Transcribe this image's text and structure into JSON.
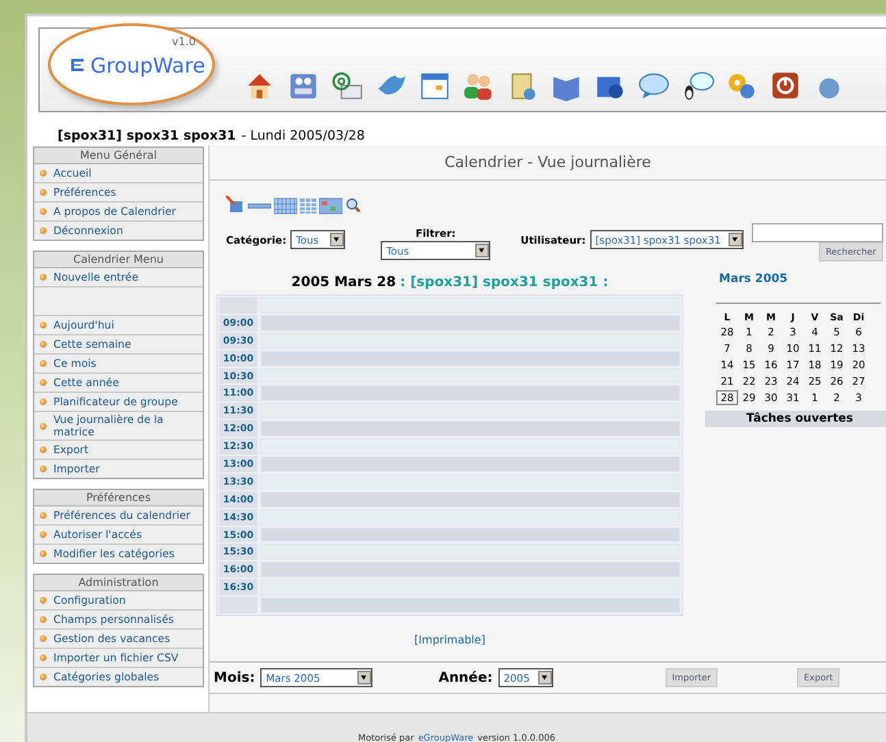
{
  "logo": {
    "version": "v1.0",
    "name": "GroupWare"
  },
  "user_line": {
    "user": "[spox31] spox31 spox31",
    "date": "- Lundi 2005/03/28"
  },
  "sidebar": [
    {
      "title": "Menu Général",
      "items": [
        {
          "kind": "link",
          "label": "Accueil"
        },
        {
          "kind": "link",
          "label": "Préférences"
        },
        {
          "kind": "link",
          "label": "A propos de Calendrier"
        },
        {
          "kind": "link",
          "label": "Déconnexion"
        }
      ]
    },
    {
      "title": "Calendrier Menu",
      "items": [
        {
          "kind": "link",
          "label": "Nouvelle entrée"
        },
        {
          "kind": "spacer"
        },
        {
          "kind": "link",
          "label": "Aujourd'hui"
        },
        {
          "kind": "link",
          "label": "Cette semaine"
        },
        {
          "kind": "link",
          "label": "Ce mois"
        },
        {
          "kind": "link",
          "label": "Cette année"
        },
        {
          "kind": "link",
          "label": "Planificateur de groupe"
        },
        {
          "kind": "link",
          "label": "Vue journalière de la matrice"
        },
        {
          "kind": "link",
          "label": "Export"
        },
        {
          "kind": "link",
          "label": "Importer"
        }
      ]
    },
    {
      "title": "Préférences",
      "items": [
        {
          "kind": "link",
          "label": "Préférences du calendrier"
        },
        {
          "kind": "link",
          "label": "Autoriser l'accés"
        },
        {
          "kind": "link",
          "label": "Modifier les catégories"
        }
      ]
    },
    {
      "title": "Administration",
      "items": [
        {
          "kind": "link",
          "label": "Configuration"
        },
        {
          "kind": "link",
          "label": "Champs personnalisés"
        },
        {
          "kind": "link",
          "label": "Gestion des vacances"
        },
        {
          "kind": "link",
          "label": "Importer un fichier CSV"
        },
        {
          "kind": "link",
          "label": "Catégories globales"
        }
      ]
    }
  ],
  "page_title": "Calendrier - Vue journalière",
  "filters": {
    "category_label": "Catégorie:",
    "category_value": "Tous",
    "filter_label": "Filtrer:",
    "filter_value": "Tous",
    "user_label": "Utilisateur:",
    "user_value": "[spox31] spox31 spox31",
    "search_button": "Rechercher"
  },
  "day_heading": {
    "date": "2005 Mars 28",
    "user": ": [spox31] spox31 spox31 :"
  },
  "slots": [
    "09:00",
    "09:30",
    "10:00",
    "10:30",
    "11:00",
    "11:30",
    "12:00",
    "12:30",
    "13:00",
    "13:30",
    "14:00",
    "14:30",
    "15:00",
    "15:30",
    "16:00",
    "16:30"
  ],
  "printable_link": "[Imprimable]",
  "mini_calendar": {
    "title": "Mars 2005",
    "weekdays": [
      "L",
      "M",
      "M",
      "J",
      "V",
      "Sa",
      "Di"
    ],
    "weeks": [
      [
        {
          "label": "28",
          "selected": false
        },
        {
          "label": "1",
          "selected": false
        },
        {
          "label": "2",
          "selected": false
        },
        {
          "label": "3",
          "selected": false
        },
        {
          "label": "4",
          "selected": false
        },
        {
          "label": "5",
          "selected": false
        },
        {
          "label": "6",
          "selected": false
        }
      ],
      [
        {
          "label": "7",
          "selected": false
        },
        {
          "label": "8",
          "selected": false
        },
        {
          "label": "9",
          "selected": false
        },
        {
          "label": "10",
          "selected": false
        },
        {
          "label": "11",
          "selected": false
        },
        {
          "label": "12",
          "selected": false
        },
        {
          "label": "13",
          "selected": false
        }
      ],
      [
        {
          "label": "14",
          "selected": false
        },
        {
          "label": "15",
          "selected": false
        },
        {
          "label": "16",
          "selected": false
        },
        {
          "label": "17",
          "selected": false
        },
        {
          "label": "18",
          "selected": false
        },
        {
          "label": "19",
          "selected": false
        },
        {
          "label": "20",
          "selected": false
        }
      ],
      [
        {
          "label": "21",
          "selected": false
        },
        {
          "label": "22",
          "selected": false
        },
        {
          "label": "23",
          "selected": false
        },
        {
          "label": "24",
          "selected": false
        },
        {
          "label": "25",
          "selected": false
        },
        {
          "label": "26",
          "selected": false
        },
        {
          "label": "27",
          "selected": false
        }
      ],
      [
        {
          "label": "28",
          "selected": true
        },
        {
          "label": "29",
          "selected": false
        },
        {
          "label": "30",
          "selected": false
        },
        {
          "label": "31",
          "selected": false
        },
        {
          "label": "1",
          "selected": false
        },
        {
          "label": "2",
          "selected": false
        },
        {
          "label": "3",
          "selected": false
        }
      ]
    ]
  },
  "open_tasks": "Tâches ouvertes",
  "bottom_bar": {
    "month_label": "Mois:",
    "month_value": "Mars 2005",
    "year_label": "Année:",
    "year_value": "2005",
    "import_button": "Importer",
    "export_button": "Export"
  },
  "footer": {
    "prefix": "Motorisé par",
    "link": "eGroupWare",
    "suffix": "version 1.0.0.006"
  }
}
